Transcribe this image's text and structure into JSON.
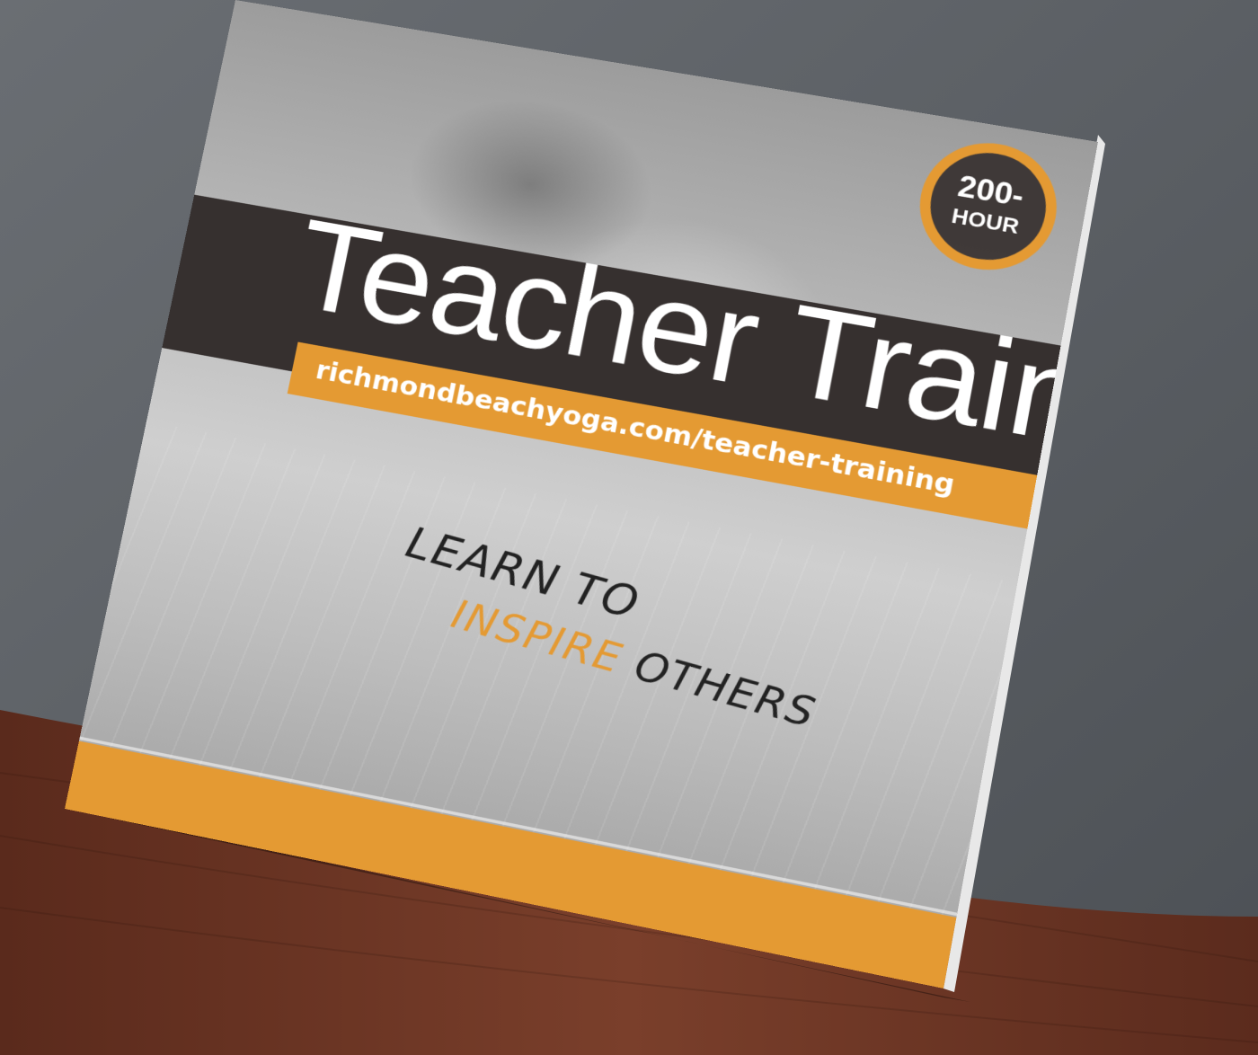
{
  "cover": {
    "title": "Teacher Training",
    "url": "richmondbeachyoga.com/teacher-training",
    "badge": {
      "line1": "200-",
      "line2": "HOUR"
    },
    "tagline": {
      "line1": "LEARN TO",
      "highlight": "INSPIRE",
      "line2_rest": " OTHERS"
    }
  },
  "colors": {
    "accent": "#e49a33",
    "band": "#36302f",
    "table_wood": "#6a3424",
    "backdrop": "#5a5e63"
  }
}
